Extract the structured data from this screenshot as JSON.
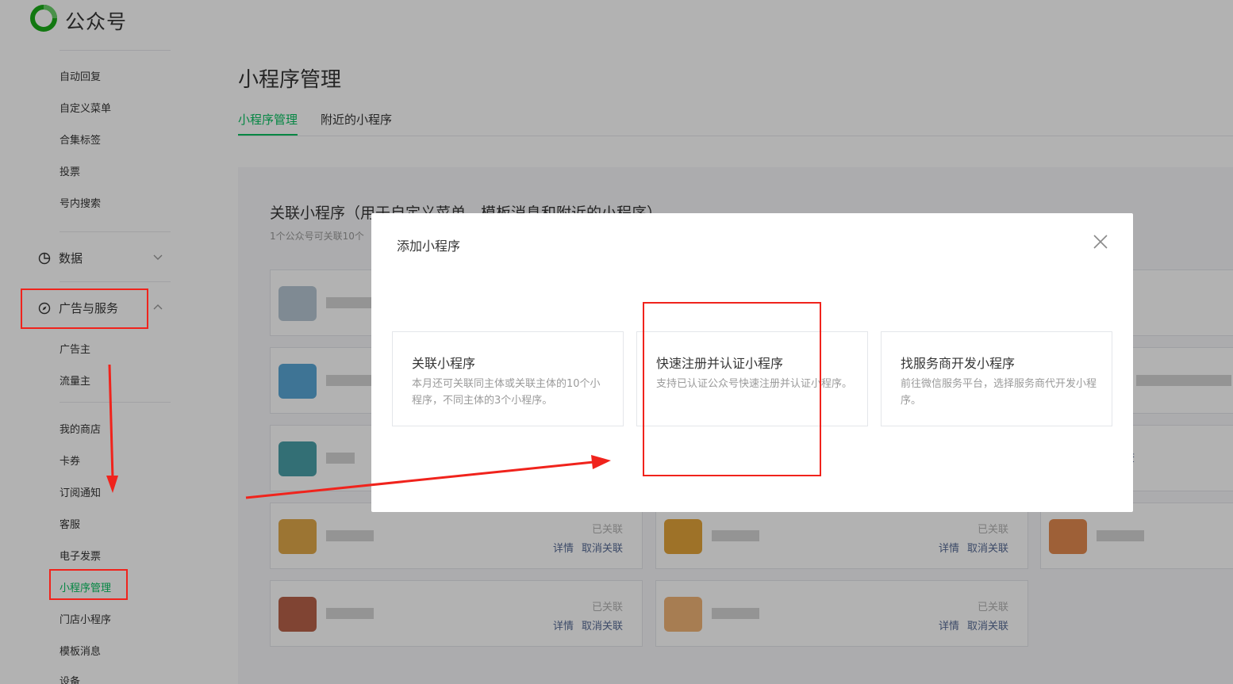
{
  "header": {
    "brand": "公众号"
  },
  "sidebar": {
    "items_top": [
      "自动回复",
      "自定义菜单",
      "合集标签",
      "投票",
      "号内搜索"
    ],
    "group_data": "数据",
    "group_ads": "广告与服务",
    "items_ads": [
      "广告主",
      "流量主"
    ],
    "items_bottom": [
      "我的商店",
      "卡券",
      "订阅通知",
      "客服",
      "电子发票",
      "小程序管理",
      "门店小程序",
      "模板消息",
      "设备"
    ]
  },
  "main": {
    "title": "小程序管理",
    "tabs": [
      {
        "label": "小程序管理",
        "active": true
      },
      {
        "label": "附近的小程序",
        "active": false
      }
    ],
    "section_title": "关联小程序（用于自定义菜单、模板消息和附近的小程序）",
    "section_sub": "1个公众号可关联10个",
    "partial_label": "查",
    "cards": [
      {
        "status": "已关联",
        "detail": "详情",
        "unlink": "取消关联"
      },
      {
        "status": "已关联",
        "detail": "详情",
        "unlink": "取消关联"
      },
      {
        "status": "已关联",
        "detail": "详情",
        "unlink": "取消关联"
      },
      {
        "status": "已关联",
        "detail": "详情",
        "unlink": "取消关联"
      }
    ]
  },
  "modal": {
    "title": "添加小程序",
    "options": [
      {
        "title": "关联小程序",
        "desc": "本月还可关联同主体或关联主体的10个小程序，不同主体的3个小程序。"
      },
      {
        "title": "快速注册并认证小程序",
        "desc": "支持已认证公众号快速注册并认证小程序。"
      },
      {
        "title": "找服务商开发小程序",
        "desc": "前往微信服务平台，选择服务商代开发小程序。"
      }
    ]
  },
  "colors": {
    "accent": "#07c160",
    "link": "#576b95",
    "annotation": "#f0231c"
  }
}
